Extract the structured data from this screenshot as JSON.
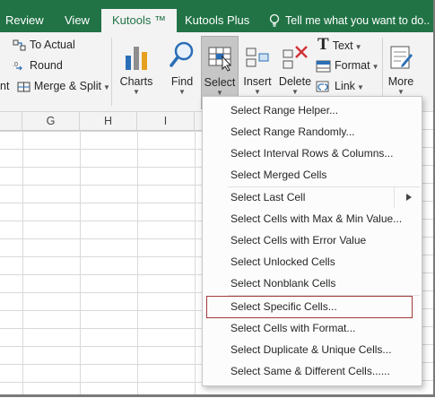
{
  "tabs": [
    {
      "label": "Review",
      "active": false
    },
    {
      "label": "View",
      "active": false
    },
    {
      "label": "Kutools ™",
      "active": true
    },
    {
      "label": "Kutools Plus",
      "active": false
    }
  ],
  "tell_me": "Tell me what you want to do..",
  "ribbon": {
    "left_group": [
      "To Actual",
      "Round",
      "Merge & Split"
    ],
    "left_partial": "nt",
    "buttons": {
      "charts": "Charts",
      "find": "Find",
      "select": "Select",
      "insert": "Insert",
      "delete": "Delete",
      "more": "More"
    },
    "right_group": [
      "Text",
      "Format",
      "Link"
    ]
  },
  "columns": [
    "G",
    "H",
    "I"
  ],
  "menu": {
    "items": [
      "Select Range Helper...",
      "Select Range Randomly...",
      "Select Interval Rows & Columns...",
      "Select Merged Cells",
      "Select Last Cell",
      "Select Cells with Max & Min Value...",
      "Select Cells with Error Value",
      "Select Unlocked Cells",
      "Select Nonblank Cells",
      "Select Specific Cells...",
      "Select Cells with Format...",
      "Select Duplicate & Unique Cells...",
      "Select Same & Different Cells......"
    ],
    "highlighted": "Select Specific Cells..."
  },
  "colors": {
    "accent": "#217346",
    "highlight_border": "#a23b3b"
  }
}
